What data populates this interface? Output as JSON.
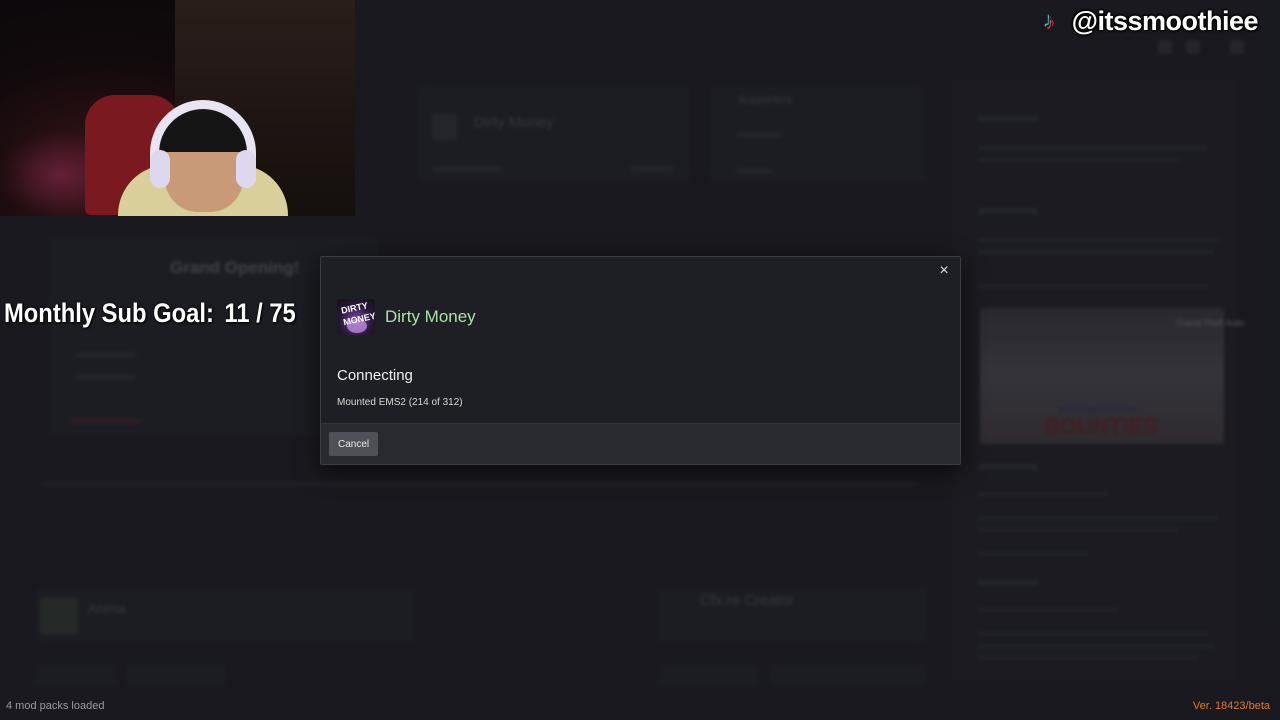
{
  "overlay": {
    "tiktok_handle": "@itssmoothiee",
    "sub_goal_label": "Monthly Sub Goal:",
    "sub_goal_count": "11 / 75"
  },
  "dialog": {
    "close_glyph": "×",
    "server_logo_text": [
      "DIRTY",
      "MONEY"
    ],
    "server_name": "Dirty Money",
    "status_title": "Connecting",
    "status_detail": "Mounted EMS2 (214 of 312)",
    "cancel_label": "Cancel"
  },
  "background": {
    "server_card_title": "Dirty Money",
    "news_title": "Grand Opening!",
    "recent_label": "Arena",
    "create_label": "Cfx.re Creator",
    "support_label": "Supporters",
    "banner_top": "Grand Theft Auto",
    "banner_bottom": "BOUNTIES",
    "banner_sub": "BOTTOM DOLLAR"
  },
  "status_bar": {
    "mod_packs": "4 mod packs loaded",
    "version": "Ver. 18423/beta"
  },
  "colors": {
    "server_name": "#a7e3a8",
    "version": "#e07a2a",
    "background": "#1c1d22"
  }
}
